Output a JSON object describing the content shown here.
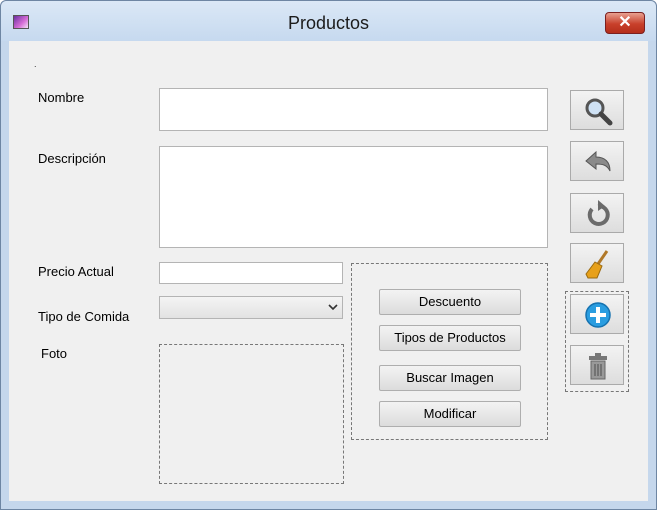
{
  "window": {
    "title": "Productos",
    "close_label": "✕"
  },
  "form": {
    "dot": ".",
    "nombre_label": "Nombre",
    "nombre_value": "",
    "descripcion_label": "Descripción",
    "descripcion_value": "",
    "precio_label": "Precio Actual",
    "precio_value": "",
    "tipo_label": "Tipo de Comida",
    "tipo_value": "",
    "foto_label": "Foto"
  },
  "actions": {
    "descuento": "Descuento",
    "tipos_productos": "Tipos de Productos",
    "buscar_imagen": "Buscar Imagen",
    "modificar": "Modificar"
  },
  "toolbar_icons": [
    "search-icon",
    "back-arrow-icon",
    "refresh-icon",
    "broom-icon",
    "add-icon",
    "trash-icon"
  ],
  "colors": {
    "close_button": "#c8402b",
    "add_icon": "#2a9de0",
    "broom": "#e7a01a"
  }
}
